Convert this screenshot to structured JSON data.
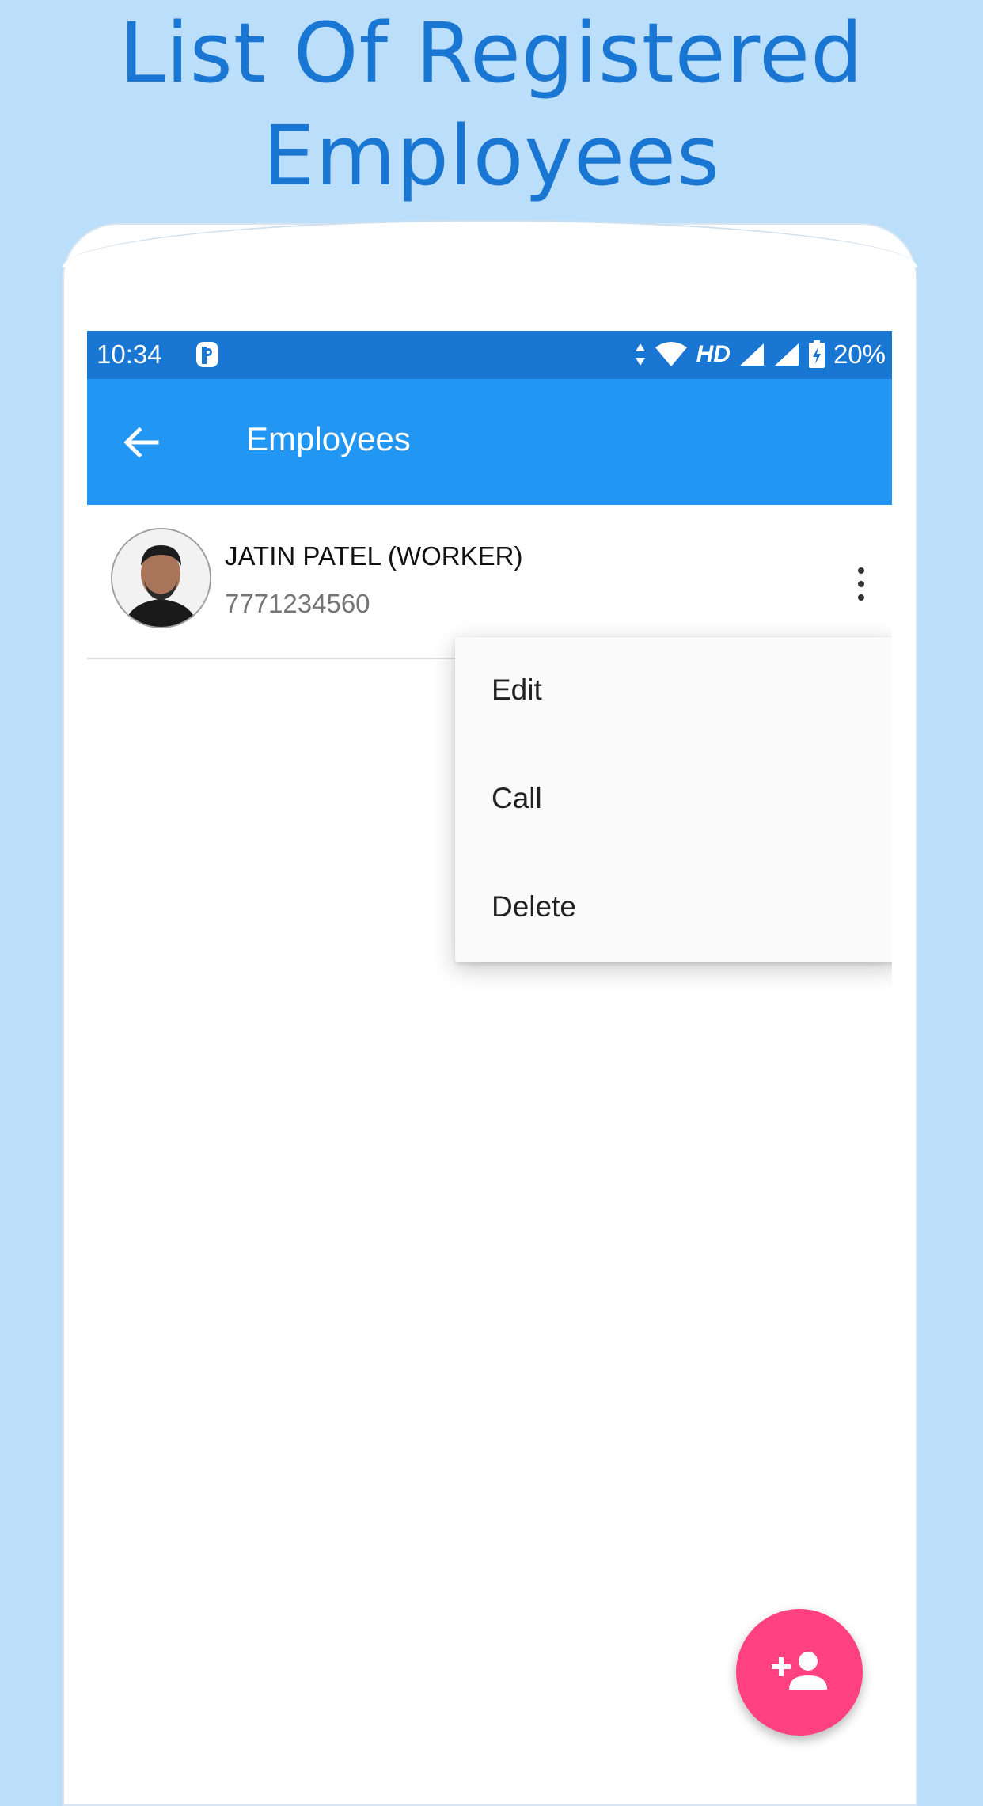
{
  "promo": {
    "headline_line1": "List Of Registered",
    "headline_line2": "Employees",
    "background_color": "#bbdefb",
    "headline_color": "#1976d2"
  },
  "status_bar": {
    "time": "10:34",
    "network_label": "HD",
    "battery": "20%",
    "color": "#1976d2"
  },
  "app_bar": {
    "title": "Employees",
    "back_icon": "arrow-back-icon",
    "color": "#2196f3"
  },
  "employees": [
    {
      "name": "JATIN PATEL (WORKER)",
      "phone": "7771234560"
    }
  ],
  "context_menu": {
    "items": [
      "Edit",
      "Call",
      "Delete"
    ]
  },
  "fab": {
    "icon": "person-add-icon",
    "color": "#ff4081"
  }
}
